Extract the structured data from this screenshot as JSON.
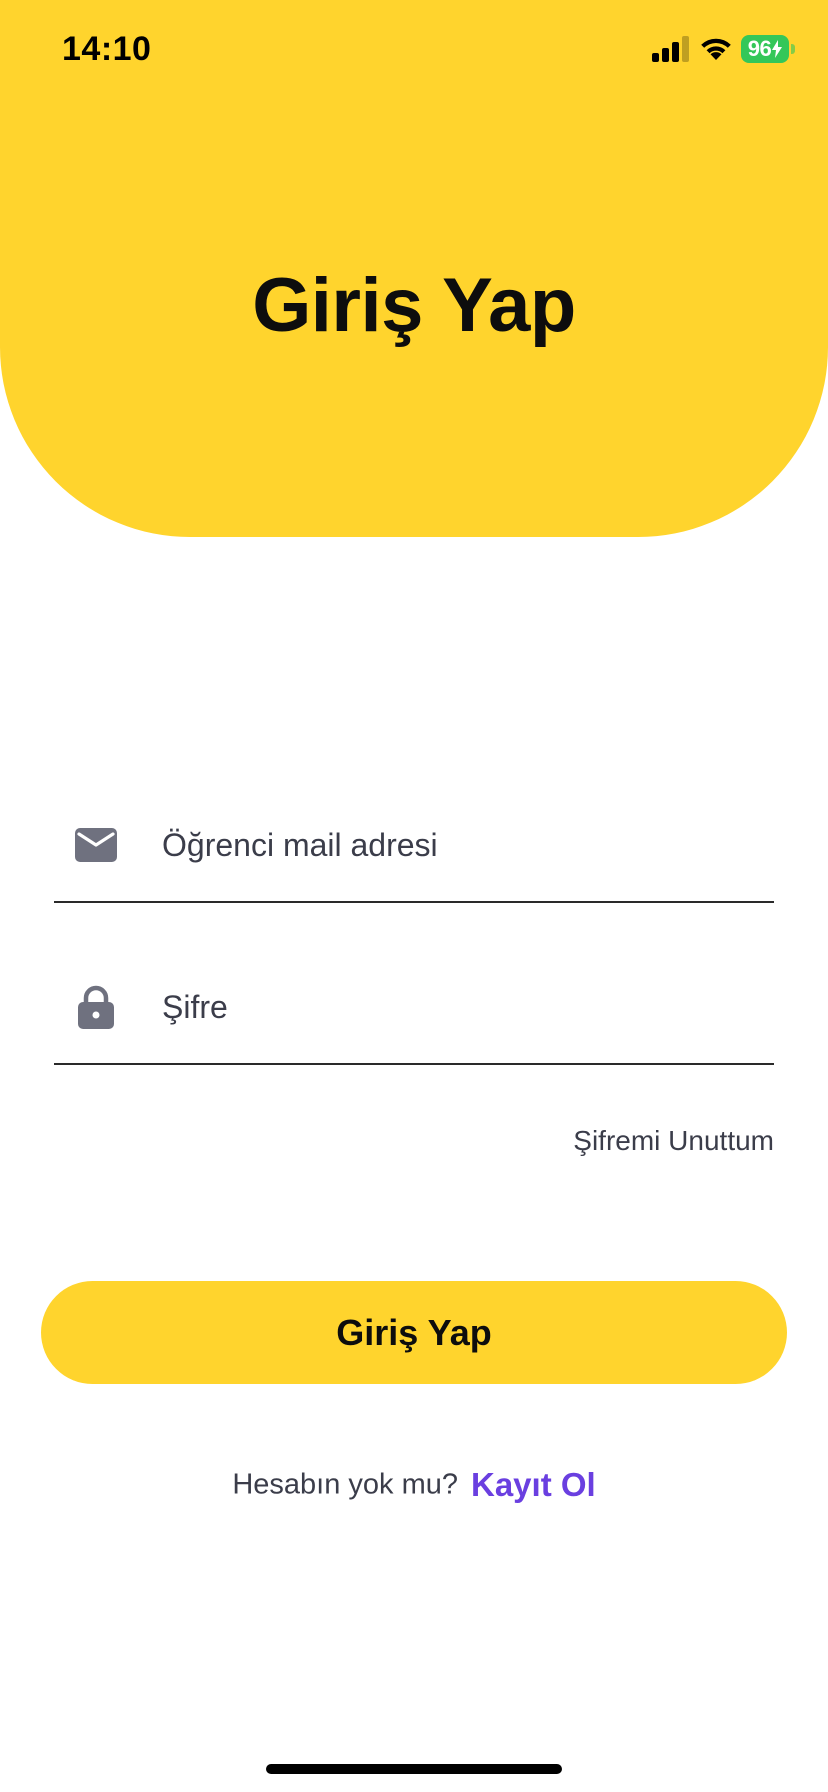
{
  "status_bar": {
    "time": "14:10",
    "battery_level": "96",
    "signal_bars": 3,
    "battery_color": "#34C759"
  },
  "header": {
    "title": "Giriş Yap",
    "background_color": "#FFD42D"
  },
  "form": {
    "email": {
      "icon": "mail-icon",
      "placeholder": "Öğrenci mail adresi",
      "value": ""
    },
    "password": {
      "icon": "lock-icon",
      "placeholder": "Şifre",
      "value": ""
    },
    "forgot_password_label": "Şifremi Unuttum",
    "login_button_label": "Giriş Yap"
  },
  "register": {
    "prompt": "Hesabın yok mu?",
    "link_label": "Kayıt Ol",
    "link_color": "#6A3FE0"
  }
}
